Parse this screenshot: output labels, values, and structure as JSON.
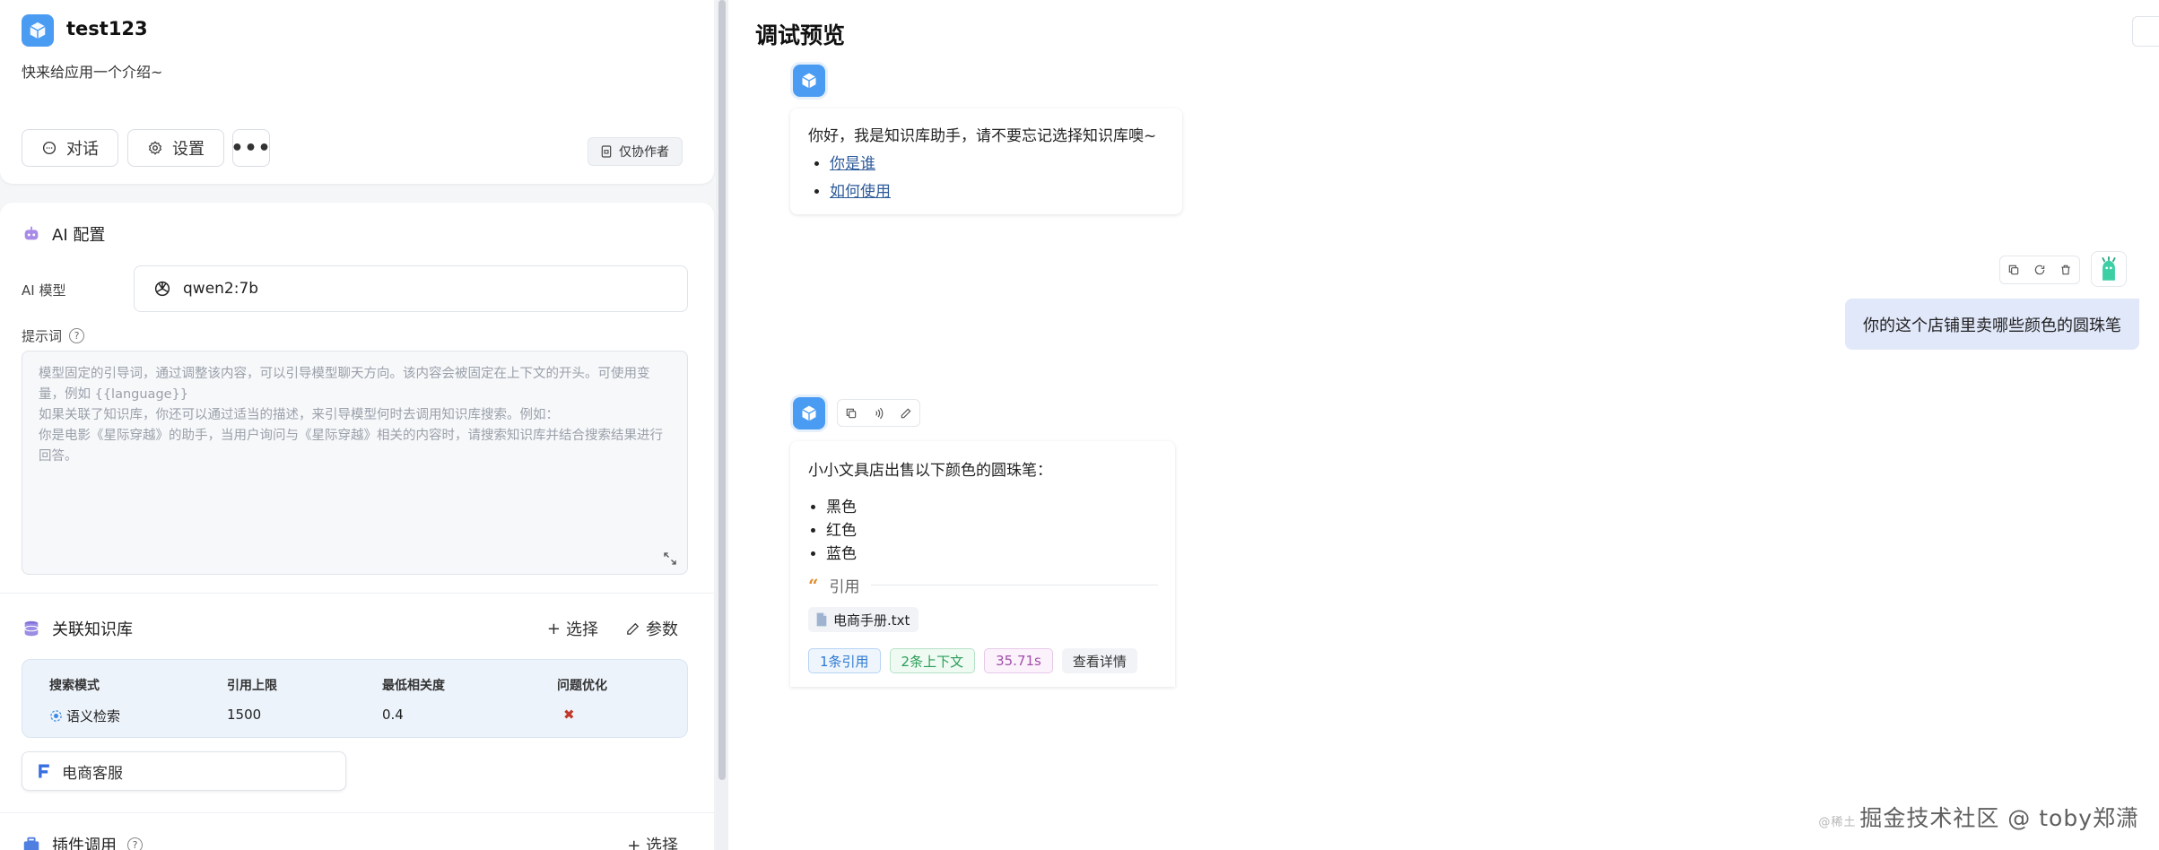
{
  "app": {
    "name": "test123",
    "intro": "快来给应用一个介绍~",
    "buttons": {
      "chat": "对话",
      "settings": "设置",
      "more": "•••"
    },
    "collab": "仅协作者"
  },
  "ai_config": {
    "title": "AI 配置",
    "model_label": "AI 模型",
    "model_value": "qwen2:7b",
    "prompt_label": "提示词",
    "prompt_help": "?",
    "prompt_placeholder_lines": [
      "模型固定的引导词，通过调整该内容，可以引导模型聊天方向。该内容会被固定在上下文的开头。可使用变量，例如 {{language}}",
      "如果关联了知识库，你还可以通过适当的描述，来引导模型何时去调用知识库搜索。例如：",
      "你是电影《星际穿越》的助手，当用户询问与《星际穿越》相关的内容时，请搜索知识库并结合搜索结果进行回答。"
    ]
  },
  "knowledge": {
    "title": "关联知识库",
    "select_label": "选择",
    "params_label": "参数",
    "headers": [
      "搜索模式",
      "引用上限",
      "最低相关度",
      "问题优化"
    ],
    "row": {
      "mode": "语义检索",
      "limit": "1500",
      "similarity": "0.4",
      "optimize": "✖"
    },
    "dataset_name": "电商客服"
  },
  "plugins": {
    "title": "插件调用",
    "help": "?",
    "select_label": "选择"
  },
  "preview": {
    "title": "调试预览",
    "welcome": {
      "text": "你好，我是知识库助手，请不要忘记选择知识库噢~",
      "links": [
        "你是谁",
        "如何使用"
      ]
    },
    "user_message": "你的这个店铺里卖哪些颜色的圆珠笔",
    "answer": {
      "intro": "小小文具店出售以下颜色的圆珠笔：",
      "items": [
        "黑色",
        "红色",
        "蓝色"
      ],
      "quote_label": "引用",
      "file": "电商手册.txt",
      "tags": {
        "refs": "1条引用",
        "context": "2条上下文",
        "time": "35.71s",
        "details": "查看详情"
      }
    }
  },
  "watermark": {
    "prefix": "@稀土",
    "text": "掘金技术社区 @ toby郑潇"
  },
  "colors": {
    "accent": "#4a9cf3",
    "user_bubble": "#e1e8fa",
    "link": "#2c5a9a"
  }
}
